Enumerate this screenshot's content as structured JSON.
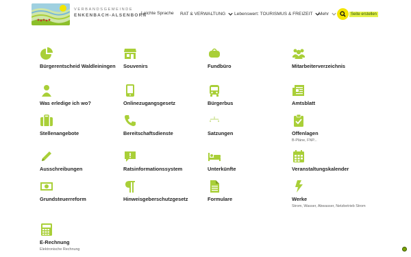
{
  "header": {
    "brand_line1": "VERBANDSGEMEINDE",
    "brand_line2": "ENKENBACH-ALSENBORN",
    "nav": [
      {
        "label": "Leichte Sprache",
        "chevron": false
      },
      {
        "label": "RAT & VERWALTUNG",
        "chevron": true
      },
      {
        "label": "Lebenswert: TOURISMUS & FREIZEIT",
        "chevron": true
      },
      {
        "label": "Mehr",
        "chevron": true
      }
    ],
    "search_icon": "search-icon",
    "edit_link": "Seite erstellen"
  },
  "accent_color": "#a9cf38",
  "tiles": [
    {
      "icon": "pie-chart-icon",
      "title": "Bürgerentscheid Waldleiningen",
      "sub": ""
    },
    {
      "icon": "store-icon",
      "title": "Souvenirs",
      "sub": ""
    },
    {
      "icon": "purse-icon",
      "title": "Fundbüro",
      "sub": ""
    },
    {
      "icon": "users-icon",
      "title": "Mitarbeiterverzeichnis",
      "sub": ""
    },
    {
      "icon": "user-icon",
      "title": "Was erledige ich wo?",
      "sub": ""
    },
    {
      "icon": "tablet-icon",
      "title": "Onlinezugangsgesetz",
      "sub": ""
    },
    {
      "icon": "bus-icon",
      "title": "Bürgerbus",
      "sub": ""
    },
    {
      "icon": "newspaper-icon",
      "title": "Amtsblatt",
      "sub": ""
    },
    {
      "icon": "suitcase-icon",
      "title": "Stellenangebote",
      "sub": ""
    },
    {
      "icon": "phone-icon",
      "title": "Bereitschaftsdienste",
      "sub": ""
    },
    {
      "icon": "scale-icon",
      "title": "Satzungen",
      "sub": ""
    },
    {
      "icon": "clipboard-check-icon",
      "title": "Offenlagen",
      "sub": "B-Pläne, FNP..."
    },
    {
      "icon": "pencil-icon",
      "title": "Ausschreibungen",
      "sub": ""
    },
    {
      "icon": "comment-icon",
      "title": "Ratsinformationssystem",
      "sub": ""
    },
    {
      "icon": "bed-icon",
      "title": "Unterkünfte",
      "sub": ""
    },
    {
      "icon": "calendar-icon",
      "title": "Veranstaltungskalender",
      "sub": ""
    },
    {
      "icon": "money-icon",
      "title": "Grundsteuerreform",
      "sub": ""
    },
    {
      "icon": "paragraph-icon",
      "title": "Hinweisgeberschutzgesetz",
      "sub": ""
    },
    {
      "icon": "file-icon",
      "title": "Formulare",
      "sub": ""
    },
    {
      "icon": "bolt-icon",
      "title": "Werke",
      "sub": "Strom, Wasser, Abwasser, Netzbetrieb Strom"
    },
    {
      "icon": "calculator-icon",
      "title": "E-Rechnung",
      "sub": "Elektronische Rechnung"
    }
  ]
}
